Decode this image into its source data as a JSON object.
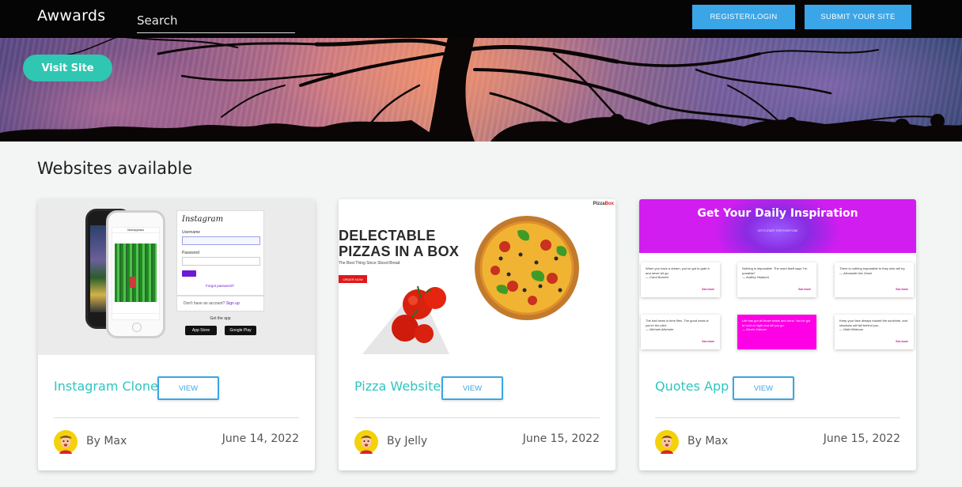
{
  "navbar": {
    "brand": "Awwards",
    "search_placeholder": "Search",
    "register_label": "REGISTER/LOGIN",
    "submit_label": "SUBMIT YOUR SITE"
  },
  "hero": {
    "visit_label": "Visit Site"
  },
  "section": {
    "title": "Websites available"
  },
  "cards": [
    {
      "title": "Instagram Clone",
      "view_label": "VIEW",
      "author": "By Max",
      "date": "June 14, 2022",
      "preview": {
        "logo": "Instagram",
        "username_label": "Username",
        "password_label": "Password",
        "forgot": "Forgot password?",
        "no_account": "Don't have an account?",
        "signup": "Sign up",
        "get_app": "Get the app",
        "appstore": "App Store",
        "googleplay": "Google Play"
      }
    },
    {
      "title": "Pizza Website",
      "view_label": "VIEW",
      "author": "By Jelly",
      "date": "June 15, 2022",
      "preview": {
        "logo_a": "Pizza",
        "logo_b": "Box",
        "headline_1": "DELECTABLE",
        "headline_2": "PIZZAS IN A BOX",
        "sub": "The Best Thing Since Sliced Bread",
        "button": "ORDER NOW"
      }
    },
    {
      "title": "Quotes App",
      "view_label": "VIEW",
      "author": "By Max",
      "date": "June 15, 2022",
      "preview": {
        "headline": "Get Your Daily Inspiration",
        "sub": "GET'S START FOR EVERYONE",
        "more": "See more",
        "quotes": [
          {
            "text": "When you have a dream, you've got to grab it and never let go.",
            "author": "— Carol Burnett"
          },
          {
            "text": "Nothing is impossible. The word itself says 'I'm possible!'",
            "author": "— Audrey Hepburn"
          },
          {
            "text": "There is nothing impossible to they who will try.",
            "author": "— Alexander the Great"
          },
          {
            "text": "The bad news is time flies. The good news is you're the pilot.",
            "author": "— Michael Altshuler"
          },
          {
            "text": "Life has got all those twists and turns. You've got to hold on tight and off you go.",
            "author": "— Nicole Kidman"
          },
          {
            "text": "Keep your face always toward the sunshine, and shadows will fall behind you.",
            "author": "— Walt Whitman"
          }
        ]
      }
    }
  ]
}
